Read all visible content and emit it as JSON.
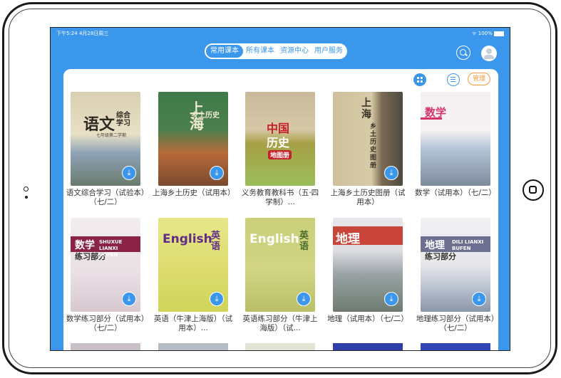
{
  "statusbar": {
    "time": "下午5:24  4月28日周三",
    "battery": "100%"
  },
  "tabs": [
    {
      "label": "常用课本"
    },
    {
      "label": "所有课本"
    },
    {
      "label": "资源中心"
    },
    {
      "label": "用户服务"
    }
  ],
  "toolbar": {
    "manage_label": "管理"
  },
  "books": [
    {
      "title": "语文综合学习（试验本）（七/二）",
      "cover_text": "语文",
      "cover_sub": "综合学习",
      "cover_sub2": "七年级第二学期"
    },
    {
      "title": "上海乡土历史（试用本）",
      "cover_text": "上海",
      "cover_sub": "乡土历史"
    },
    {
      "title": "义务教育教科书（五·四学制）...",
      "cover_text": "中国",
      "cover_sub": "历史",
      "cover_sub2": "地图册"
    },
    {
      "title": "上海乡土历史图册（试用本）",
      "cover_text": "上海",
      "cover_sub": "乡土历史图册"
    },
    {
      "title": "数学（试用本）（七/二）",
      "cover_text": "数学"
    },
    {
      "title": "数学练习部分（试用本）（七/二）",
      "cover_text": "数学",
      "cover_sub": "练习部分",
      "cover_latin": "SHUXUE LIANXI BUFEN"
    },
    {
      "title": "英语（牛津上海版）（试用本）...",
      "cover_text": "English",
      "cover_sub": "英语"
    },
    {
      "title": "英语练习部分（牛津上海版）（试...",
      "cover_text": "English",
      "cover_sub": "英语"
    },
    {
      "title": "地理（试用本）（七/二）",
      "cover_text": "地理"
    },
    {
      "title": "地理练习部分（试用本）（七/二）",
      "cover_text": "地理",
      "cover_sub": "练习部分",
      "cover_latin": "DILI LIANXI BUFEN"
    }
  ]
}
